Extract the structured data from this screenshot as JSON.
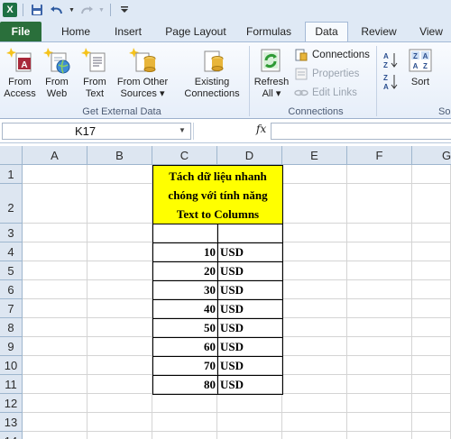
{
  "qat": {
    "app_letter": "X"
  },
  "tabs": [
    "File",
    "Home",
    "Insert",
    "Page Layout",
    "Formulas",
    "Data",
    "Review",
    "View"
  ],
  "ribbon": {
    "get_external": {
      "buttons": [
        {
          "line1": "From",
          "line2": "Access"
        },
        {
          "line1": "From",
          "line2": "Web"
        },
        {
          "line1": "From",
          "line2": "Text"
        },
        {
          "line1": "From Other",
          "line2": "Sources ▾"
        },
        {
          "line1": "Existing",
          "line2": "Connections"
        }
      ],
      "label": "Get External Data"
    },
    "connections": {
      "refresh_line1": "Refresh",
      "refresh_line2": "All ▾",
      "items": [
        "Connections",
        "Properties",
        "Edit Links"
      ],
      "label": "Connections"
    },
    "sort": {
      "label": "Sort",
      "group_partial": "So"
    }
  },
  "formula_bar": {
    "name_box": "K17",
    "fx": "fx",
    "value": ""
  },
  "columns": [
    "A",
    "B",
    "C",
    "D",
    "E",
    "F",
    "G"
  ],
  "rows": [
    "1",
    "2",
    "3",
    "4",
    "5",
    "6",
    "7",
    "8",
    "9",
    "10",
    "11",
    "12",
    "13",
    "14"
  ],
  "sheet": {
    "title_lines": [
      "Tách dữ liệu nhanh",
      "chóng với tính năng",
      "Text to Columns"
    ],
    "values": [
      "10",
      "20",
      "30",
      "40",
      "50",
      "60",
      "70",
      "80"
    ],
    "unit": "USD"
  },
  "colors": {
    "title_fill": "#ffff00",
    "file_tab": "#2a6f3b",
    "header_bg": "#dde6f1"
  }
}
